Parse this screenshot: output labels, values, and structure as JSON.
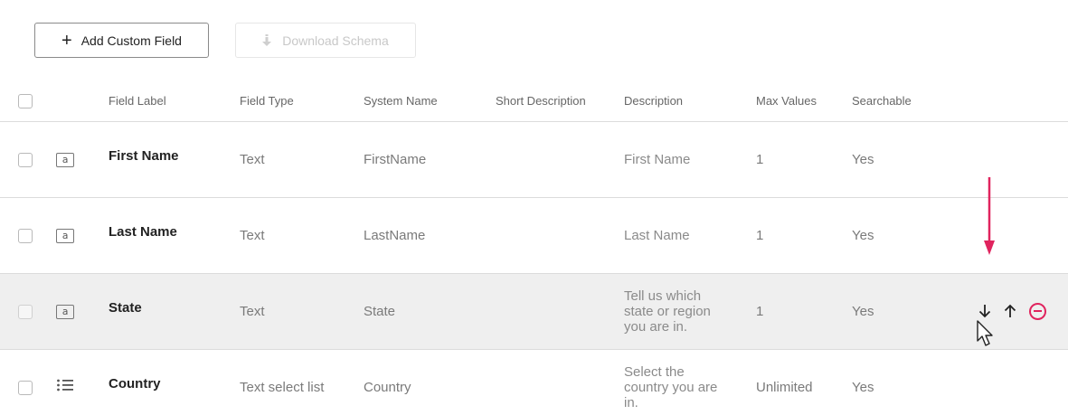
{
  "toolbar": {
    "add_label": "Add Custom Field",
    "add_icon": "plus-icon",
    "download_label": "Download Schema",
    "download_icon": "download-icon"
  },
  "columns": [
    "Field Label",
    "Field Type",
    "System Name",
    "Short Description",
    "Description",
    "Max Values",
    "Searchable"
  ],
  "rows": [
    {
      "icon": "text-type-icon",
      "icon_glyph": "a",
      "label": "First Name",
      "type": "Text",
      "system": "FirstName",
      "short": "",
      "description": [
        "First Name"
      ],
      "max": "1",
      "searchable": "Yes"
    },
    {
      "icon": "text-type-icon",
      "icon_glyph": "a",
      "label": "Last Name",
      "type": "Text",
      "system": "LastName",
      "short": "",
      "description": [
        "Last Name"
      ],
      "max": "1",
      "searchable": "Yes"
    },
    {
      "icon": "text-type-icon",
      "icon_glyph": "a",
      "label": "State",
      "type": "Text",
      "system": "State",
      "short": "",
      "description": [
        "Tell us which",
        "state or region",
        "you are in."
      ],
      "max": "1",
      "searchable": "Yes"
    },
    {
      "icon": "list-type-icon",
      "icon_glyph": "",
      "label": "Country",
      "type": "Text select list",
      "system": "Country",
      "short": "",
      "description": [
        "Select the",
        "country you are",
        "in."
      ],
      "max": "Unlimited",
      "searchable": "Yes"
    }
  ],
  "row_actions": {
    "move_down_icon": "arrow-down-icon",
    "move_up_icon": "arrow-up-icon",
    "remove_icon": "minus-circle-icon"
  },
  "colors": {
    "accent_pink": "#e0245e",
    "row_hover": "#efefef",
    "border": "#dcdcdc"
  }
}
